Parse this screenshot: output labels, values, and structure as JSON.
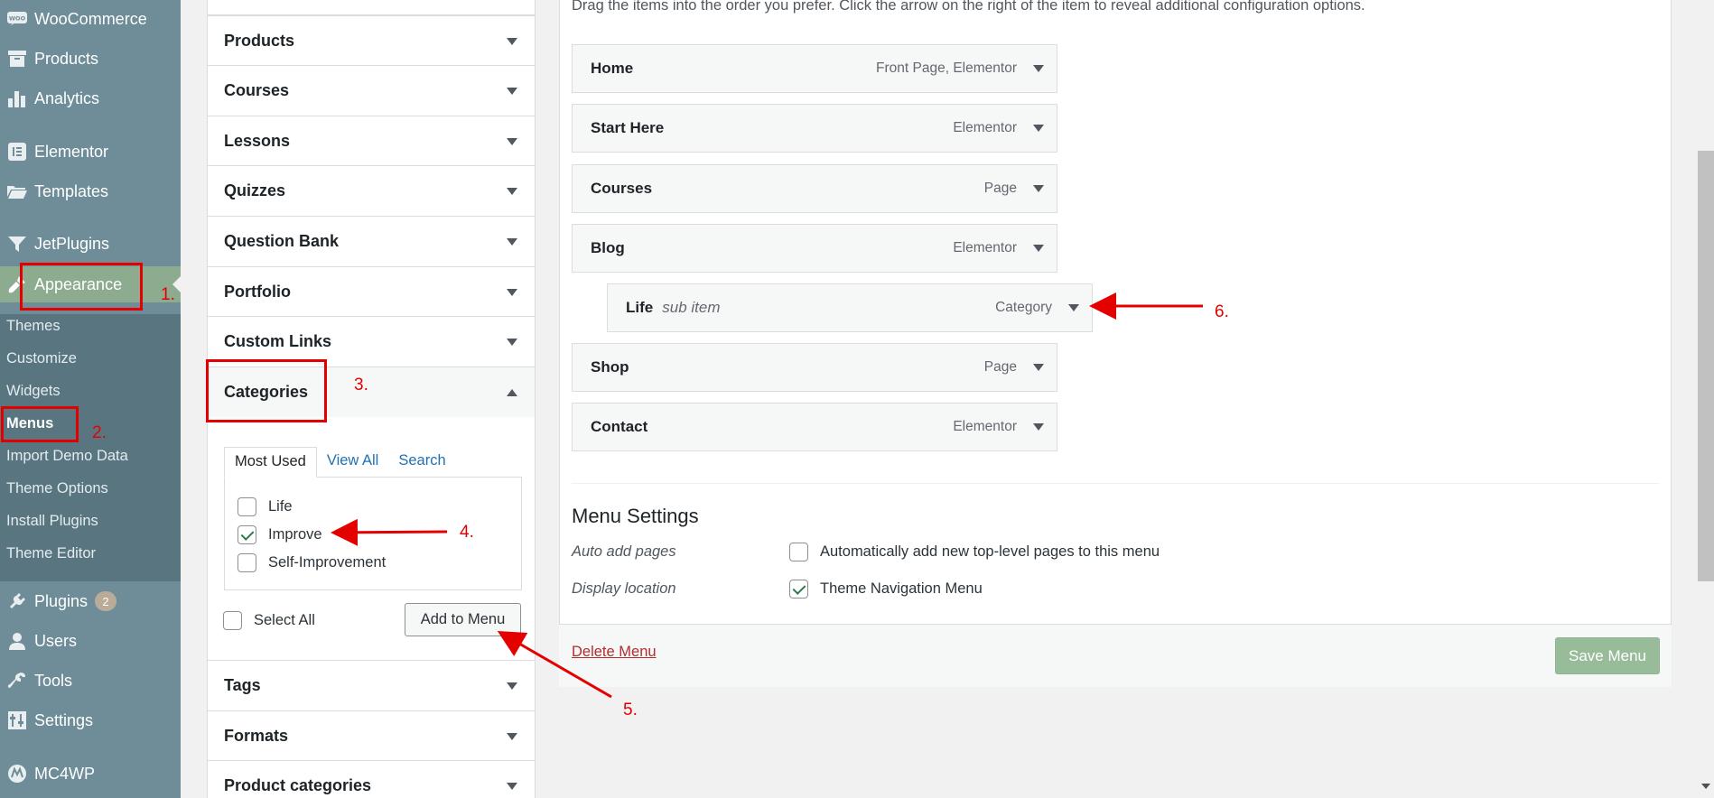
{
  "sidebar": {
    "items": [
      {
        "label": "WooCommerce",
        "icon": "woo-icon"
      },
      {
        "label": "Products",
        "icon": "archive-icon"
      },
      {
        "label": "Analytics",
        "icon": "bar-chart-icon"
      },
      {
        "label": "Elementor",
        "icon": "elementor-icon"
      },
      {
        "label": "Templates",
        "icon": "folder-icon"
      },
      {
        "label": "JetPlugins",
        "icon": "filter-icon"
      },
      {
        "label": "Appearance",
        "icon": "paintbrush-icon"
      },
      {
        "label": "Plugins",
        "icon": "plugin-icon",
        "badge": "2"
      },
      {
        "label": "Users",
        "icon": "user-icon"
      },
      {
        "label": "Tools",
        "icon": "wrench-icon"
      },
      {
        "label": "Settings",
        "icon": "settings-icon"
      },
      {
        "label": "MC4WP",
        "icon": "mc4wp-icon"
      }
    ],
    "appearance_submenu": [
      "Themes",
      "Customize",
      "Widgets",
      "Menus",
      "Import Demo Data",
      "Theme Options",
      "Install Plugins",
      "Theme Editor"
    ]
  },
  "boxes": {
    "accordions": [
      "Products",
      "Courses",
      "Lessons",
      "Quizzes",
      "Question Bank",
      "Portfolio",
      "Custom Links",
      "Categories",
      "Tags",
      "Formats",
      "Product categories"
    ],
    "categories": {
      "tabs": [
        "Most Used",
        "View All",
        "Search"
      ],
      "items": [
        {
          "label": "Life",
          "checked": false
        },
        {
          "label": "Improve",
          "checked": true
        },
        {
          "label": "Self-Improvement",
          "checked": false
        }
      ],
      "select_all": "Select All",
      "add_button": "Add to Menu"
    }
  },
  "menu": {
    "instructions": "Drag the items into the order you prefer. Click the arrow on the right of the item to reveal additional configuration options.",
    "items": [
      {
        "title": "Home",
        "type": "Front Page, Elementor",
        "sub": ""
      },
      {
        "title": "Start Here",
        "type": "Elementor",
        "sub": ""
      },
      {
        "title": "Courses",
        "type": "Page",
        "sub": ""
      },
      {
        "title": "Blog",
        "type": "Elementor",
        "sub": ""
      },
      {
        "title": "Life",
        "type": "Category",
        "sub": "sub item"
      },
      {
        "title": "Shop",
        "type": "Page",
        "sub": ""
      },
      {
        "title": "Contact",
        "type": "Elementor",
        "sub": ""
      }
    ]
  },
  "settings": {
    "title": "Menu Settings",
    "auto_add_label": "Auto add pages",
    "auto_add_option": "Automatically add new top-level pages to this menu",
    "auto_add_checked": false,
    "location_label": "Display location",
    "location_option": "Theme Navigation Menu",
    "location_checked": true
  },
  "footer": {
    "delete": "Delete Menu",
    "save": "Save Menu"
  },
  "annotations": [
    "1.",
    "2.",
    "3.",
    "4.",
    "5.",
    "6."
  ],
  "colors": {
    "sidebar": "#6f8d98",
    "submenu": "#587580",
    "active": "#8cab8f",
    "annotation": "#e50000",
    "link": "#2271b1",
    "save": "#98bb9a"
  }
}
